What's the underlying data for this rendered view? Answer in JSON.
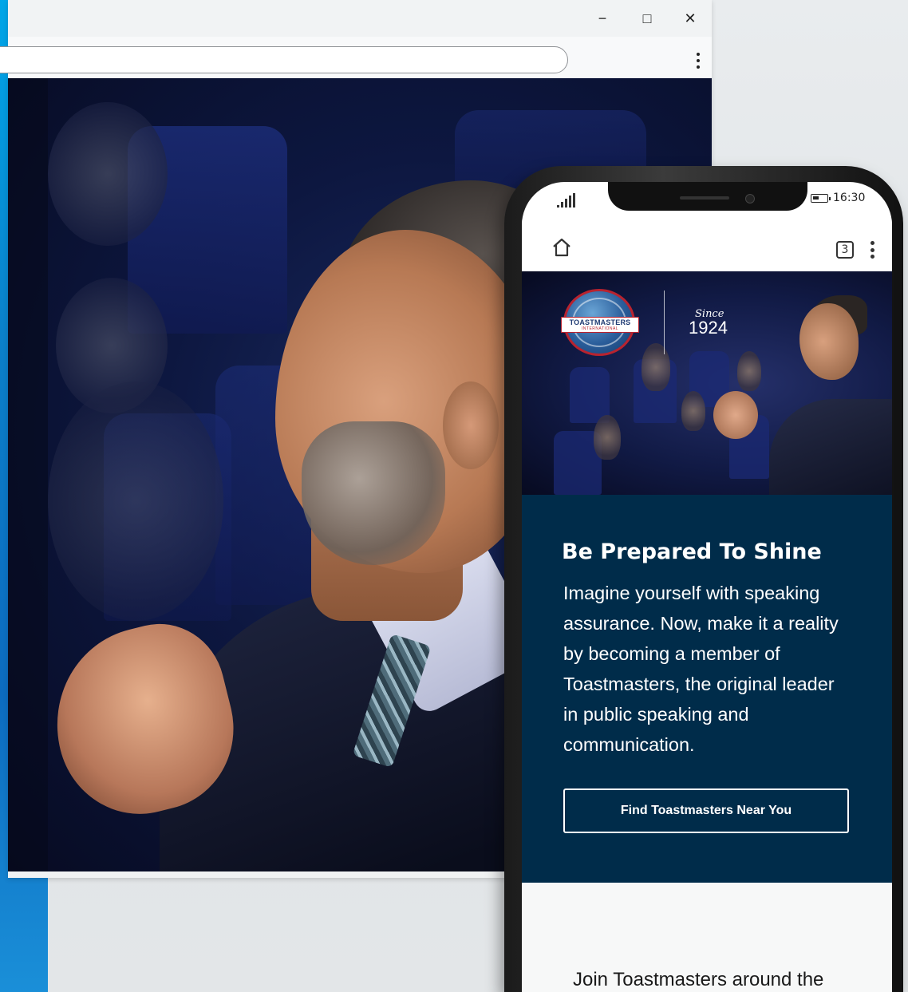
{
  "browser": {
    "controls": {
      "minimize": "−",
      "maximize": "□",
      "close": "✕"
    }
  },
  "phone": {
    "status": {
      "time": "16:30"
    },
    "toolbar": {
      "tab_count": "3"
    },
    "hero": {
      "logo_text": "TOASTMASTERS",
      "logo_subtext": "INTERNATIONAL",
      "since_label": "Since",
      "since_year": "1924"
    },
    "content": {
      "title": "Be Prepared To Shine",
      "body": "Imagine yourself with speaking assurance. Now, make it a reality by becoming a member of Toastmasters, the original leader in public speaking and communication.",
      "cta": "Find Toastmasters Near You"
    },
    "below": {
      "join_text": "Join Toastmasters around the"
    }
  },
  "colors": {
    "brand_blue": "#0b7fc9",
    "panel_navy": "#002c4a",
    "logo_red": "#b8232f"
  }
}
